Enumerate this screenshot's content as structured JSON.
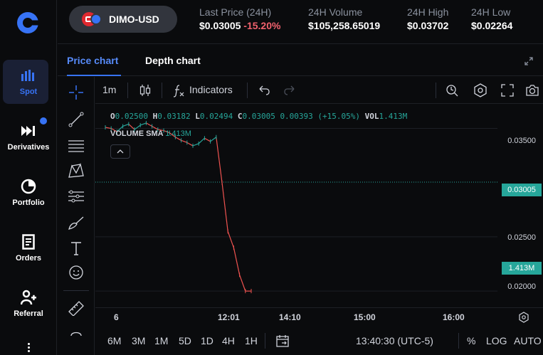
{
  "nav": {
    "items": [
      {
        "label": "Spot",
        "icon": "bar-chart-icon",
        "active": true
      },
      {
        "label": "Derivatives",
        "icon": "fast-forward-icon",
        "badge": true
      },
      {
        "label": "Portfolio",
        "icon": "pie-chart-icon"
      },
      {
        "label": "Orders",
        "icon": "document-icon"
      },
      {
        "label": "Referral",
        "icon": "add-user-icon"
      }
    ]
  },
  "header": {
    "pair": "DIMO-USD",
    "last_price_label": "Last Price (24H)",
    "last_price": "$0.03005",
    "change": "-15.20%",
    "volume_label": "24H Volume",
    "volume": "$105,258.65019",
    "high_label": "24H High",
    "high": "$0.03702",
    "low_label": "24H Low",
    "low": "$0.02264"
  },
  "tabs": [
    "Price chart",
    "Depth chart"
  ],
  "toolbar": {
    "interval": "1m",
    "indicators_label": "Indicators"
  },
  "legend": {
    "o_label": "O",
    "o": "0.02500",
    "h_label": "H",
    "h": "0.03182",
    "l_label": "L",
    "l": "0.02494",
    "c_label": "C",
    "c": "0.03005",
    "change": "0.00393 (+15.05%)",
    "vol_label": "VOL",
    "vol": "1.413M",
    "sma_label": "VOLUME SMA",
    "sma": "1.413M"
  },
  "yaxis": {
    "ticks": [
      "0.03500",
      "0.02500",
      "0.02000"
    ],
    "last_price_tag": "0.03005",
    "volume_tag": "1.413M"
  },
  "xaxis": {
    "ticks": [
      "6",
      "12:01",
      "14:10",
      "15:00",
      "16:00"
    ]
  },
  "bottom": {
    "ranges": [
      "6M",
      "3M",
      "1M",
      "5D",
      "1D",
      "4H",
      "1H"
    ],
    "time": "13:40:30 (UTC-5)",
    "percent": "%",
    "log": "LOG",
    "auto": "AUTO"
  },
  "colors": {
    "accent": "#3773f5",
    "up": "#26a69a",
    "down": "#ef5350",
    "negative_text": "#f0616d"
  },
  "chart_data": {
    "type": "line",
    "price_ylim": [
      0.0185,
      0.0372
    ],
    "last_price": 0.03005,
    "series": [
      {
        "values": [
          0.0351,
          0.035,
          0.0347,
          0.0352,
          0.0354,
          0.0349,
          0.0353,
          0.0355,
          0.0352,
          0.0349,
          0.0348,
          0.0346,
          0.0342,
          0.0339,
          0.0337,
          0.0334,
          0.0336,
          0.0341,
          0.0338,
          0.0342,
          0.03,
          0.0255,
          0.024,
          0.0215,
          0.02,
          0.02
        ]
      }
    ]
  }
}
